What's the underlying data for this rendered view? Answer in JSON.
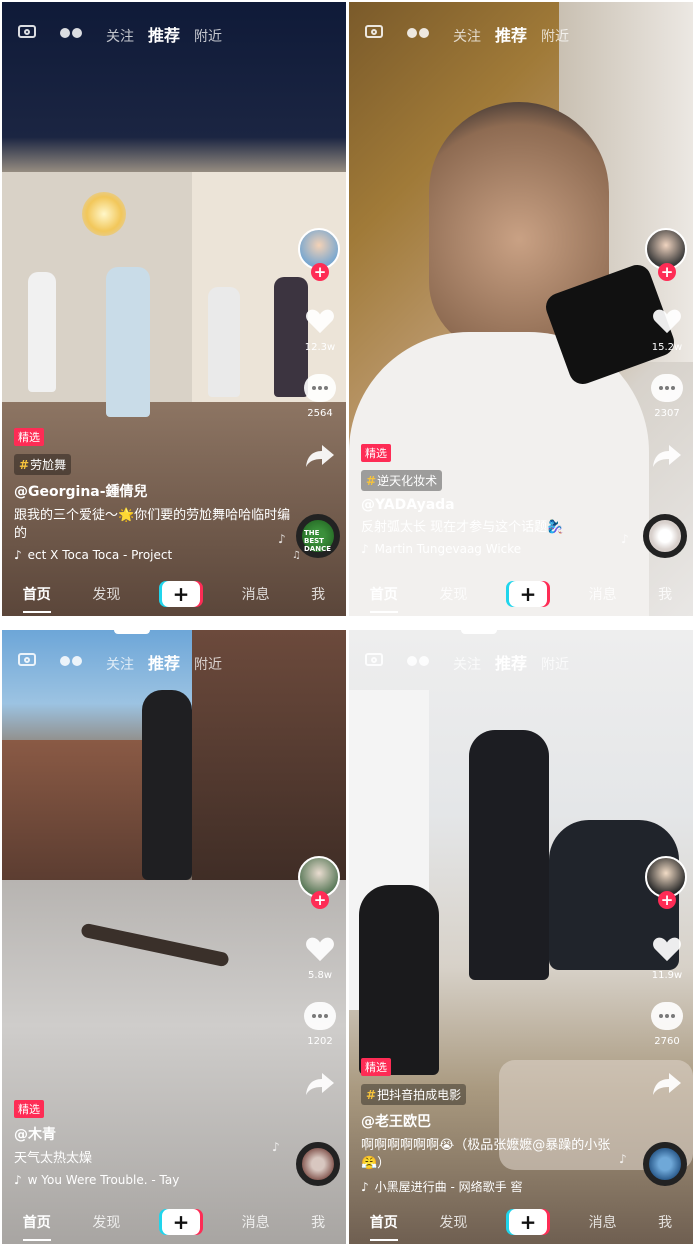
{
  "nav": {
    "top_tabs": [
      "关注",
      "推荐",
      "附近"
    ],
    "bottom": {
      "home": "首页",
      "discover": "发现",
      "create": "+",
      "messages": "消息",
      "me": "我"
    }
  },
  "panels": [
    {
      "likes": "12.3w",
      "comments": "2564",
      "badge": "精选",
      "topic": "劳尬舞",
      "username": "@Georgina-鍾倩兒",
      "description": "跟我的三个爱徒～🌟你们要的劳尬舞哈哈临时编的",
      "music": "ect X   Toca Toca - Project",
      "disc_text": "THE BEST DANCE"
    },
    {
      "likes": "15.2w",
      "comments": "2307",
      "badge": "精选",
      "topic": "逆天化妆术",
      "username": "@YADAyada",
      "description": "反射弧太长 现在才参与这个话题🧞‍♀️",
      "music": "Martin Tungevaag   Wicke",
      "disc_text": ""
    },
    {
      "likes": "5.8w",
      "comments": "1202",
      "badge": "精选",
      "topic": "",
      "username": "@木青",
      "description": "天气太热太燥",
      "music": "w You Were Trouble. - Tay",
      "disc_text": ""
    },
    {
      "likes": "11.9w",
      "comments": "2760",
      "badge": "精选",
      "topic": "把抖音拍成电影",
      "username": "@老王欧巴",
      "description": "啊啊啊啊啊啊😭（极品张嬷嬷@暴躁的小张😤）",
      "music": "小黑屋进行曲 - 网络歌手    窖",
      "disc_text": ""
    }
  ],
  "colors": {
    "accent_red": "#fe2c55",
    "accent_cyan": "#20d5ec",
    "topic_hash": "#f6c33b"
  }
}
